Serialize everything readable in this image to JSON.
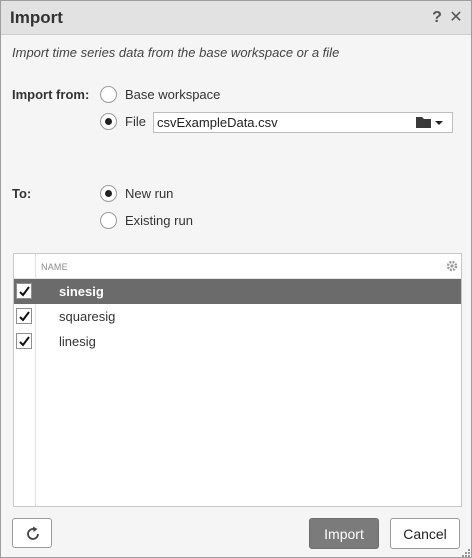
{
  "dialog": {
    "title": "Import",
    "help_icon": "?",
    "close_icon": "✕",
    "description": "Import time series data from the base workspace or a file"
  },
  "import_from": {
    "label": "Import from:",
    "options": [
      {
        "label": "Base workspace",
        "selected": false
      },
      {
        "label": "File",
        "selected": true
      }
    ],
    "file_value": "csvExampleData.csv",
    "folder_icon": "folder-icon"
  },
  "to": {
    "label": "To:",
    "options": [
      {
        "label": "New run",
        "selected": true
      },
      {
        "label": "Existing run",
        "selected": false
      }
    ]
  },
  "table": {
    "column_header": "NAME",
    "settings_icon": "gear-icon",
    "rows": [
      {
        "name": "sinesig",
        "checked": true,
        "selected": true
      },
      {
        "name": "squaresig",
        "checked": true,
        "selected": false
      },
      {
        "name": "linesig",
        "checked": true,
        "selected": false
      }
    ]
  },
  "footer": {
    "refresh_icon": "refresh-icon",
    "import_label": "Import",
    "cancel_label": "Cancel"
  },
  "colors": {
    "titlebar": "#e2e2e2",
    "selected_row": "#6b6b6b",
    "primary_button": "#7b7b7b"
  }
}
